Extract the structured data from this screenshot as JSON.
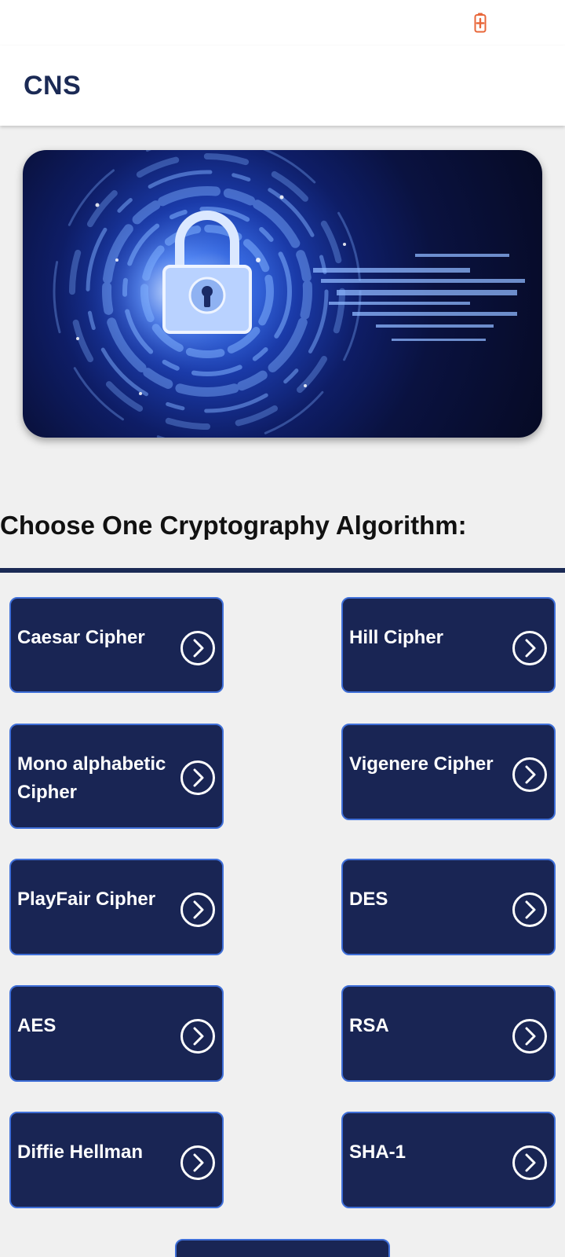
{
  "status_bar": {
    "battery_icon": "battery-charging-icon",
    "battery_color": "#e8673a"
  },
  "app_bar": {
    "title": "CNS",
    "title_color": "#1b2a55"
  },
  "banner": {
    "image": "padlock-cyber-security-illustration"
  },
  "section": {
    "heading": "Choose One Cryptography Algorithm:"
  },
  "algorithms": [
    {
      "label": "Caesar Cipher",
      "icon": "chevron-right-circle-icon"
    },
    {
      "label": "Hill Cipher",
      "icon": "chevron-right-circle-icon"
    },
    {
      "label": "Mono alphabetic Cipher",
      "icon": "chevron-right-circle-icon"
    },
    {
      "label": "Vigenere Cipher",
      "icon": "chevron-right-circle-icon"
    },
    {
      "label": "PlayFair Cipher",
      "icon": "chevron-right-circle-icon"
    },
    {
      "label": "DES",
      "icon": "chevron-right-circle-icon"
    },
    {
      "label": "AES",
      "icon": "chevron-right-circle-icon"
    },
    {
      "label": "RSA",
      "icon": "chevron-right-circle-icon"
    },
    {
      "label": "Diffie Hellman",
      "icon": "chevron-right-circle-icon"
    },
    {
      "label": "SHA-1",
      "icon": "chevron-right-circle-icon"
    }
  ],
  "colors": {
    "button_bg": "#192554",
    "button_border": "#3f6fd8",
    "divider": "#1b2a55",
    "page_bg": "#f0f0f0"
  }
}
